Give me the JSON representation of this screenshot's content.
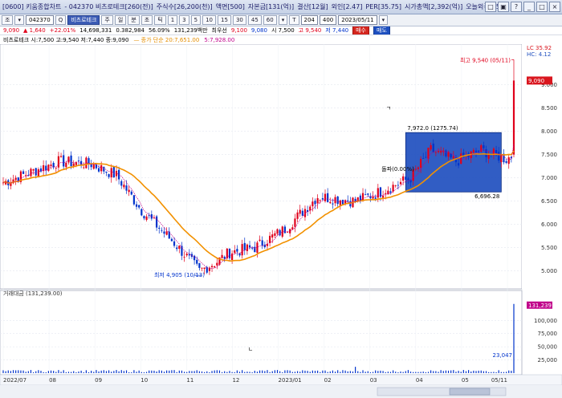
{
  "titlebar": {
    "items": [
      "[0600] 키움종합차트",
      "- 042370 비츠로테크[260(전)]",
      "주식수[26,200(천)]",
      "액면[500]",
      "자본금[131(억)]",
      "결산[12월]",
      "외인[2.47]",
      "PER[35.75]",
      "시가총액[2,392(억)]",
      "오늘외국[35.8]"
    ],
    "buttons": [
      "□",
      "▣",
      "?",
      "_",
      "□",
      "×"
    ]
  },
  "toolbar": {
    "items": [
      "조",
      "▾",
      "042370",
      "Q",
      "비츠로테크",
      "주",
      "일",
      "분",
      "초",
      "틱",
      "1",
      "3",
      "5",
      "10",
      "15",
      "30",
      "45",
      "60",
      "▾",
      "T",
      "204",
      "400",
      "2023/05/11",
      "▾"
    ]
  },
  "infobar": {
    "price": "9,090",
    "change": "▲ 1,640",
    "pct": "+22.01%",
    "volume": "14,698,331",
    "vol_pct": "0.382,984",
    "ratio": "56.09%",
    "amount": "131,239백만",
    "best": "최우선",
    "ask": "9,100",
    "bid": "9,080",
    "open": "시 7,500",
    "high": "고 9,540",
    "low": "저 7,440",
    "buy": "매수",
    "sell": "매도"
  },
  "legend": {
    "name": "비츠로테크 시:7,500 고:9,540 저:7,440 종:9,090",
    "ma": "— 종가 단순 20:7,651.00",
    "ma2": "5:7,928.00"
  },
  "volume_label": "거래대금 (131,239.00)",
  "annotations": {
    "high": "최고 9,540 (05/11)",
    "low": "최저 4,905 (10/13)",
    "box_top": "7,972.0 (1275.74)",
    "box_bottom": "6,696.28",
    "breakout": "돌파(0.00%)",
    "mark_upper": "ㄱ",
    "mark_lower": "ㄴ",
    "vol_value": "23,047",
    "vol_current": "131,239",
    "current_price": "9,090",
    "lc": "LC 35.92",
    "hc": "HC: 4.12"
  },
  "y_ticks": [
    "9.000",
    "8.500",
    "8.000",
    "7.500",
    "7.000",
    "6.500",
    "6.000",
    "5.500",
    "5.000"
  ],
  "vol_ticks": [
    "100,000",
    "75,000",
    "50,000",
    "25,000"
  ],
  "x_ticks": [
    "2022/07",
    "08",
    "09",
    "10",
    "11",
    "12",
    "2023/01",
    "02",
    "03",
    "04",
    "05",
    "05/11"
  ],
  "colors": {
    "up": "#e0001b",
    "down": "#0033cc",
    "ma20": "#f29100",
    "ma5": "#c0008a",
    "box": "#1f4fbf"
  }
}
